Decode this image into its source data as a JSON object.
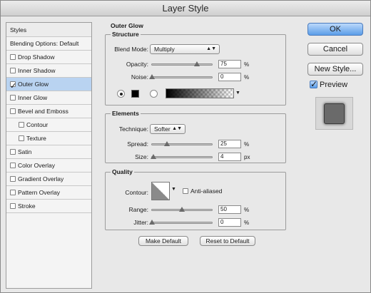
{
  "window": {
    "title": "Layer Style"
  },
  "styles": {
    "header": "Styles",
    "items": [
      {
        "label": "Blending Options: Default",
        "checkbox": false,
        "checked": false,
        "indent": false,
        "selected": false
      },
      {
        "label": "Drop Shadow",
        "checkbox": true,
        "checked": false,
        "indent": false,
        "selected": false
      },
      {
        "label": "Inner Shadow",
        "checkbox": true,
        "checked": false,
        "indent": false,
        "selected": false
      },
      {
        "label": "Outer Glow",
        "checkbox": true,
        "checked": true,
        "indent": false,
        "selected": true
      },
      {
        "label": "Inner Glow",
        "checkbox": true,
        "checked": false,
        "indent": false,
        "selected": false
      },
      {
        "label": "Bevel and Emboss",
        "checkbox": true,
        "checked": false,
        "indent": false,
        "selected": false
      },
      {
        "label": "Contour",
        "checkbox": true,
        "checked": false,
        "indent": true,
        "selected": false
      },
      {
        "label": "Texture",
        "checkbox": true,
        "checked": false,
        "indent": true,
        "selected": false
      },
      {
        "label": "Satin",
        "checkbox": true,
        "checked": false,
        "indent": false,
        "selected": false
      },
      {
        "label": "Color Overlay",
        "checkbox": true,
        "checked": false,
        "indent": false,
        "selected": false
      },
      {
        "label": "Gradient Overlay",
        "checkbox": true,
        "checked": false,
        "indent": false,
        "selected": false
      },
      {
        "label": "Pattern Overlay",
        "checkbox": true,
        "checked": false,
        "indent": false,
        "selected": false
      },
      {
        "label": "Stroke",
        "checkbox": true,
        "checked": false,
        "indent": false,
        "selected": false
      }
    ]
  },
  "outer_glow": {
    "title": "Outer Glow",
    "structure": {
      "title": "Structure",
      "blend_mode_label": "Blend Mode:",
      "blend_mode_value": "Multiply",
      "opacity_label": "Opacity:",
      "opacity_value": "75",
      "opacity_unit": "%",
      "opacity_level": 0.75,
      "noise_label": "Noise:",
      "noise_value": "0",
      "noise_unit": "%",
      "noise_level": 0,
      "glow_type": "color",
      "glow_color": "#000000"
    },
    "elements": {
      "title": "Elements",
      "technique_label": "Technique:",
      "technique_value": "Softer",
      "spread_label": "Spread:",
      "spread_value": "25",
      "spread_unit": "%",
      "spread_level": 0.25,
      "size_label": "Size:",
      "size_value": "4",
      "size_unit": "px",
      "size_level": 0.02
    },
    "quality": {
      "title": "Quality",
      "contour_label": "Contour:",
      "anti_aliased_label": "Anti-aliased",
      "anti_aliased_checked": false,
      "range_label": "Range:",
      "range_value": "50",
      "range_unit": "%",
      "range_level": 0.5,
      "jitter_label": "Jitter:",
      "jitter_value": "0",
      "jitter_unit": "%",
      "jitter_level": 0
    },
    "make_default_label": "Make Default",
    "reset_default_label": "Reset to Default"
  },
  "actions": {
    "ok_label": "OK",
    "cancel_label": "Cancel",
    "new_style_label": "New Style...",
    "preview_label": "Preview",
    "preview_checked": true
  },
  "colors": {
    "accent": "#5b9de8",
    "selection": "#b9d3f1"
  }
}
